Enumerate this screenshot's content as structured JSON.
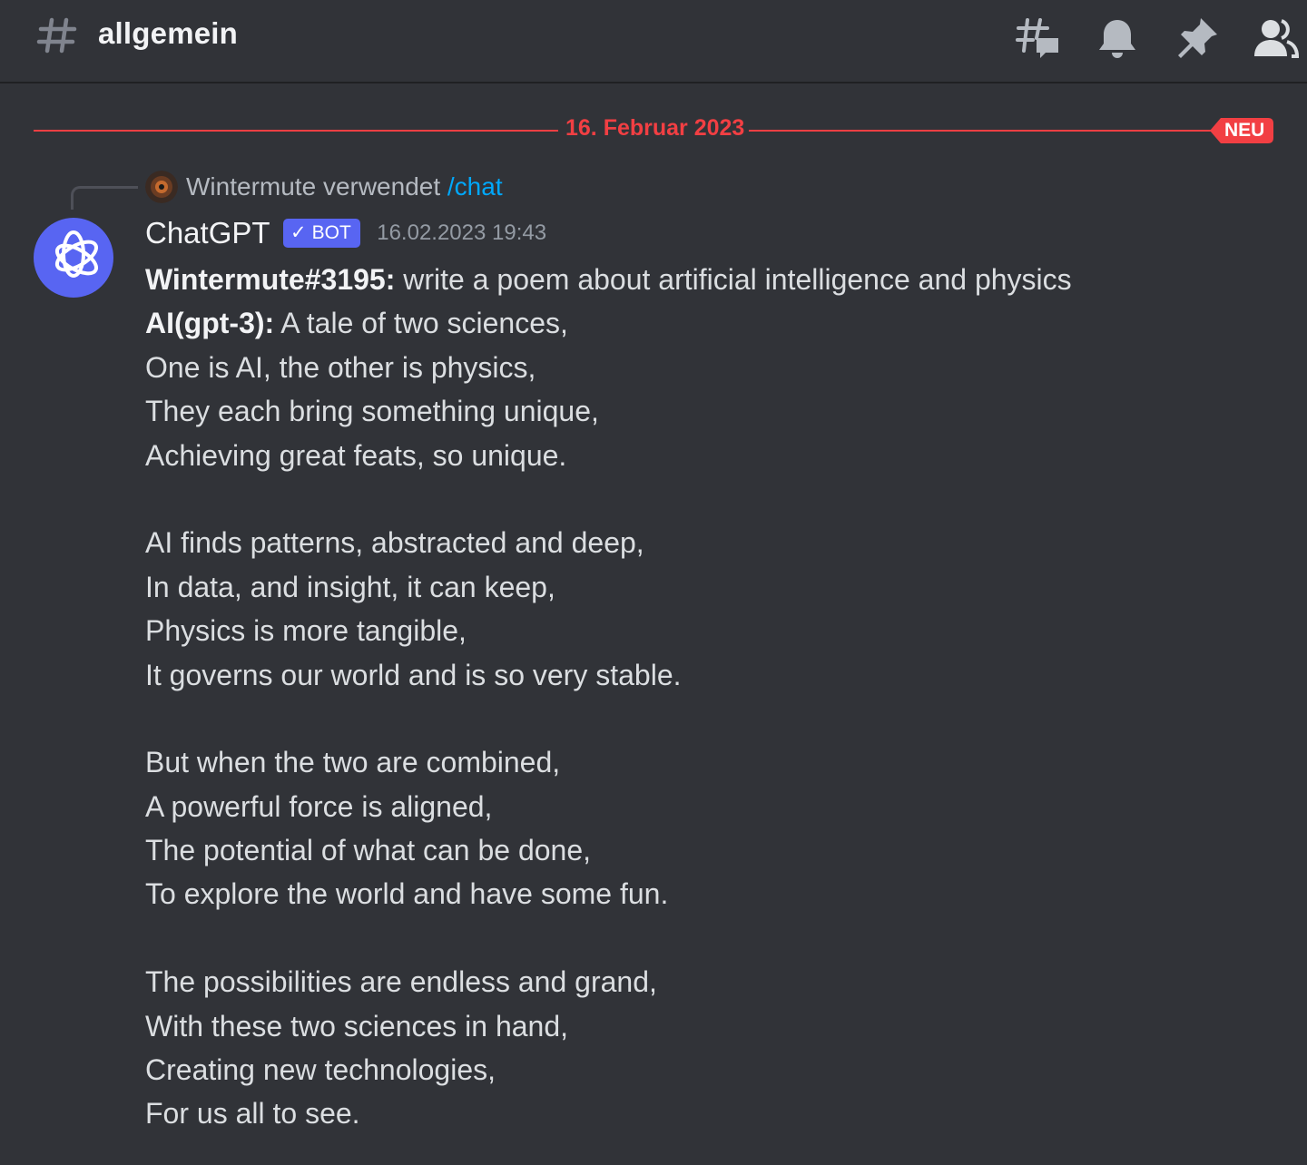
{
  "channel": {
    "hash_icon": "hashtag-icon",
    "name": "allgemein"
  },
  "toolbar": {
    "threads_icon": "threads-icon",
    "notifications_icon": "bell-icon",
    "pins_icon": "pin-icon",
    "members_icon": "members-icon"
  },
  "divider": {
    "date": "16. Februar 2023",
    "new_badge": "NEU",
    "color": "#f23f43"
  },
  "reply": {
    "user": "Wintermute",
    "verb": "verwendet",
    "command": "/chat"
  },
  "message": {
    "author": "ChatGPT",
    "bot_tag_check": "✓",
    "bot_tag": "BOT",
    "timestamp": "16.02.2023 19:43",
    "prompt_user": "Wintermute#3195:",
    "prompt_text": "write a poem about artificial intelligence and physics",
    "ai_label": "AI(gpt-3):",
    "first_line": "A tale of two sciences,",
    "lines": [
      "One is AI, the other is physics,",
      "They each bring something unique,",
      "Achieving great feats, so unique.",
      "",
      "AI finds patterns, abstracted and deep,",
      "In data, and insight, it can keep,",
      "Physics is more tangible,",
      "It governs our world and is so very stable.",
      "",
      "But when the two are combined,",
      "A powerful force is aligned,",
      "The potential of what can be done,",
      "To explore the world and have some fun.",
      "",
      "The possibilities are endless and grand,",
      "With these two sciences in hand,",
      "Creating new technologies,",
      "For us all to see."
    ]
  },
  "colors": {
    "background": "#313338",
    "accent": "#5865f2",
    "link": "#00a8fc"
  }
}
